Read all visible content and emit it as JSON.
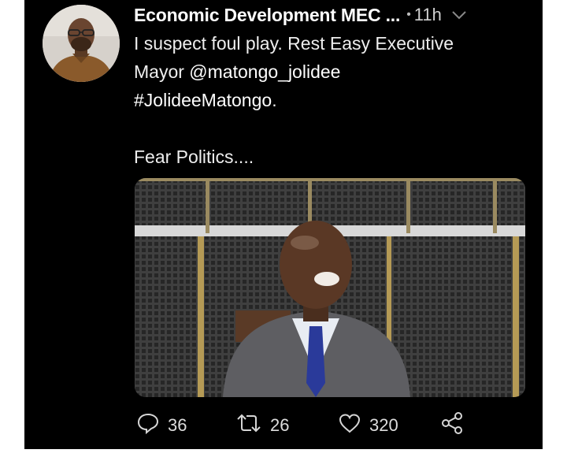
{
  "tweet": {
    "author_name": "Economic Development MEC ...",
    "separator": "•",
    "time": "11h",
    "text_line1": "I suspect foul play. Rest Easy Executive",
    "text_line2_prefix": "Mayor ",
    "mention": "@matongo_jolidee",
    "hashtag": "#JolideeMatongo",
    "hashtag_suffix": ".",
    "text_line4": "Fear Politics...."
  },
  "actions": {
    "reply_count": "36",
    "retweet_count": "26",
    "like_count": "320"
  },
  "icons": {
    "reply": "speech-bubble-icon",
    "retweet": "retweet-icon",
    "like": "heart-icon",
    "share": "share-icon",
    "caret": "chevron-down-icon"
  },
  "colors": {
    "background": "#000000",
    "text": "#eeeeee",
    "muted": "#bbbbbb"
  }
}
